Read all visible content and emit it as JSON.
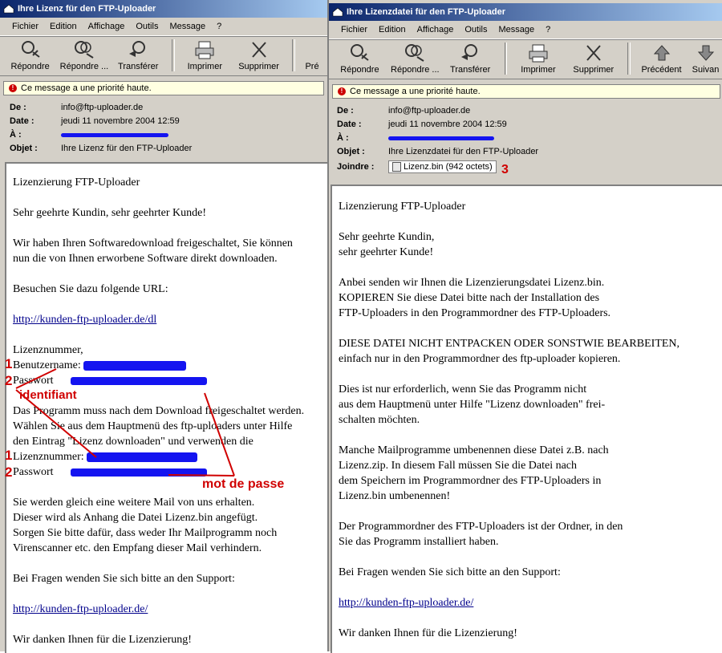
{
  "left": {
    "title": "Ihre Lizenz für den FTP-Uploader",
    "menu": [
      "Fichier",
      "Edition",
      "Affichage",
      "Outils",
      "Message",
      "?"
    ],
    "toolbar": [
      "Répondre",
      "Répondre ...",
      "Transférer",
      "Imprimer",
      "Supprimer",
      "Pré"
    ],
    "priority": "Ce message a une priorité haute.",
    "headers": {
      "de_label": "De :",
      "de": "info@ftp-uploader.de",
      "date_label": "Date :",
      "date": "jeudi 11 novembre 2004 12:59",
      "a_label": "À :",
      "objet_label": "Objet :",
      "objet": "Ihre Lizenz für den FTP-Uploader"
    },
    "body": {
      "l1": "Lizenzierung FTP-Uploader",
      "l2": "Sehr geehrte Kundin, sehr geehrter Kunde!",
      "l3": "Wir haben Ihren Softwaredownload freigeschaltet, Sie können",
      "l4": "nun die von Ihnen erworbene Software direkt downloaden.",
      "l5": "Besuchen Sie dazu folgende URL:",
      "link1": "http://kunden-ftp-uploader.de/dl",
      "l6": "Lizenznummer,",
      "l7": "Benutzername:",
      "l8": "Passwort",
      "l9": "Das Programm muss nach dem Download freigeschaltet werden.",
      "l10": "Wählen Sie aus dem Hauptmenü des ftp-uploaders unter Hilfe",
      "l11": "den Eintrag \"Lizenz downloaden\" und verwenden die",
      "l12": "Lizenznummer:",
      "l13": "Passwort",
      "l14": "Sie werden gleich eine weitere Mail von uns erhalten.",
      "l15": "Dieser wird als Anhang die Datei Lizenz.bin angefügt.",
      "l16": "Sorgen Sie bitte dafür, dass weder Ihr Mailprogramm noch",
      "l17": "Virenscanner etc. den Empfang dieser Mail verhindern.",
      "l18": "Bei Fragen wenden Sie sich bitte an den Support:",
      "link2": "http://kunden-ftp-uploader.de/",
      "l19": "Wir danken Ihnen für die Lizenzierung!"
    },
    "annotations": {
      "n1a": "1",
      "n2a": "2",
      "identifiant": "identifiant",
      "n1b": "1",
      "n2b": "2",
      "motdepasse": "mot de passe"
    }
  },
  "right": {
    "title": "Ihre Lizenzdatei für den FTP-Uploader",
    "menu": [
      "Fichier",
      "Edition",
      "Affichage",
      "Outils",
      "Message",
      "?"
    ],
    "toolbar": [
      "Répondre",
      "Répondre ...",
      "Transférer",
      "Imprimer",
      "Supprimer",
      "Précédent",
      "Suivan"
    ],
    "priority": "Ce message a une priorité haute.",
    "headers": {
      "de_label": "De :",
      "de": "info@ftp-uploader.de",
      "date_label": "Date :",
      "date": "jeudi 11 novembre 2004 12:59",
      "a_label": "À :",
      "objet_label": "Objet :",
      "objet": "Ihre Lizenzdatei für den FTP-Uploader",
      "joindre_label": "Joindre :",
      "attachment": "Lizenz.bin (942 octets)"
    },
    "annotation3": "3",
    "body": {
      "l1": "Lizenzierung FTP-Uploader",
      "l2": "Sehr geehrte Kundin,",
      "l3": "sehr geehrter Kunde!",
      "l4": "Anbei senden wir Ihnen die Lizenzierungsdatei Lizenz.bin.",
      "l5": "KOPIEREN Sie diese Datei bitte nach der Installation des",
      "l6": "FTP-Uploaders in den Programmordner des FTP-Uploaders.",
      "l7": "DIESE DATEI NICHT ENTPACKEN ODER SONSTWIE BEARBEITEN,",
      "l8": "einfach nur in den Programmordner des ftp-uploader kopieren.",
      "l9": "Dies ist nur erforderlich, wenn Sie das Programm nicht",
      "l10": "aus dem Hauptmenü unter Hilfe \"Lizenz downloaden\" frei-",
      "l11": "schalten möchten.",
      "l12": "Manche Mailprogramme umbenennen diese Datei z.B. nach",
      "l13": "Lizenz.zip. In diesem Fall müssen Sie die Datei nach",
      "l14": "dem Speichern im Programmordner des FTP-Uploaders in",
      "l15": "Lizenz.bin umbenennen!",
      "l16": "Der Programmordner des FTP-Uploaders ist der Ordner, in den",
      "l17": "Sie das Programm installiert haben.",
      "l18": "Bei Fragen wenden Sie sich bitte an den Support:",
      "link": "http://kunden-ftp-uploader.de/",
      "l19": "Wir danken Ihnen für die Lizenzierung!"
    }
  },
  "colors": {
    "titlebar": "#0a246a",
    "annotation": "#d00000",
    "scribble": "#1414f0",
    "link": "#00008b"
  }
}
